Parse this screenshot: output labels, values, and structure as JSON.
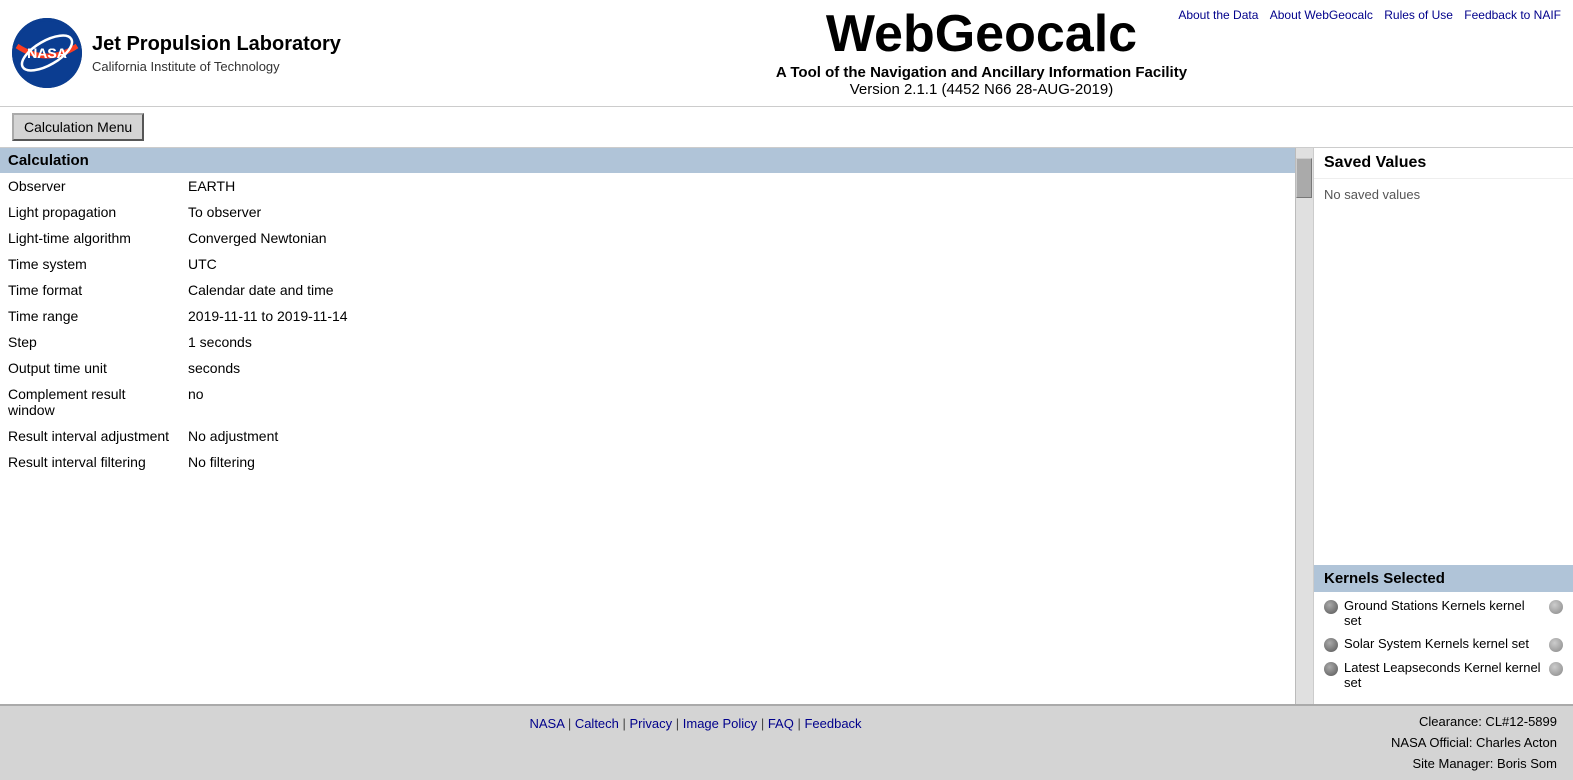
{
  "header": {
    "nasa_logo_text": "NASA",
    "jpl_title": "Jet Propulsion Laboratory",
    "jpl_subtitle": "California Institute of Technology",
    "app_title": "WebGeocalc",
    "app_subtitle": "A Tool of the Navigation and Ancillary Information Facility",
    "app_version": "Version 2.1.1 (4452 N66 28-AUG-2019)"
  },
  "top_nav": {
    "links": [
      {
        "label": "About the Data",
        "href": "#"
      },
      {
        "label": "About WebGeocalc",
        "href": "#"
      },
      {
        "label": "Rules of Use",
        "href": "#"
      },
      {
        "label": "Feedback to NAIF",
        "href": "#"
      }
    ]
  },
  "calc_menu": {
    "button_label": "Calculation Menu"
  },
  "calculation": {
    "section_title": "Calculation",
    "fields": [
      {
        "label": "Observer",
        "value": "EARTH"
      },
      {
        "label": "Light propagation",
        "value": "To observer"
      },
      {
        "label": "Light-time algorithm",
        "value": "Converged Newtonian"
      },
      {
        "label": "Time system",
        "value": "UTC"
      },
      {
        "label": "Time format",
        "value": "Calendar date and time"
      },
      {
        "label": "Time range",
        "value": "2019-11-11 to 2019-11-14"
      },
      {
        "label": "Step",
        "value": "1 seconds"
      },
      {
        "label": "Output time unit",
        "value": "seconds"
      },
      {
        "label": "Complement result window",
        "value": "no"
      },
      {
        "label": "Result interval adjustment",
        "value": "No adjustment"
      },
      {
        "label": "Result interval filtering",
        "value": "No filtering"
      }
    ]
  },
  "saved_values": {
    "title": "Saved Values",
    "empty_message": "No saved values"
  },
  "kernels": {
    "title": "Kernels Selected",
    "items": [
      {
        "label": "Ground Stations Kernels kernel set"
      },
      {
        "label": "Solar System Kernels kernel set"
      },
      {
        "label": "Latest Leapseconds Kernel kernel set"
      }
    ]
  },
  "footer": {
    "links": [
      {
        "label": "NASA",
        "href": "#"
      },
      {
        "label": "Caltech",
        "href": "#"
      },
      {
        "label": "Privacy",
        "href": "#"
      },
      {
        "label": "Image Policy",
        "href": "#"
      },
      {
        "label": "FAQ",
        "href": "#"
      },
      {
        "label": "Feedback",
        "href": "#"
      }
    ],
    "separators": [
      "|",
      "|",
      "|",
      "|",
      "|"
    ],
    "clearance": "Clearance: CL#12-5899",
    "official": "NASA Official: Charles Acton",
    "manager": "Site Manager: Boris Som"
  }
}
